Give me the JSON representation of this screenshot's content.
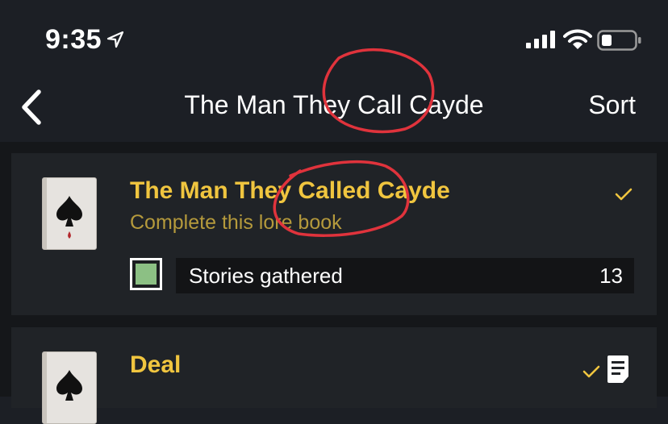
{
  "status_bar": {
    "time": "9:35"
  },
  "nav": {
    "title": "The Man They Call Cayde",
    "sort_label": "Sort"
  },
  "items": [
    {
      "title": "The Man They Called Cayde",
      "subtitle": "Complete this lore book",
      "stat_label": "Stories gathered",
      "stat_value": "13",
      "completed": true,
      "progress_color": "#8cc084"
    },
    {
      "title": "Deal",
      "completed": true,
      "has_note": true
    }
  ],
  "colors": {
    "background": "#1c1f25",
    "card": "#202327",
    "title_gold": "#f0c53f",
    "subtitle_gold": "#b59a3c",
    "annotation_red": "#e0333c"
  },
  "icons": [
    "location-arrow-icon",
    "signal-icon",
    "wifi-icon",
    "battery-icon",
    "back-chevron-icon",
    "spade-icon",
    "checkmark-icon",
    "note-icon"
  ]
}
